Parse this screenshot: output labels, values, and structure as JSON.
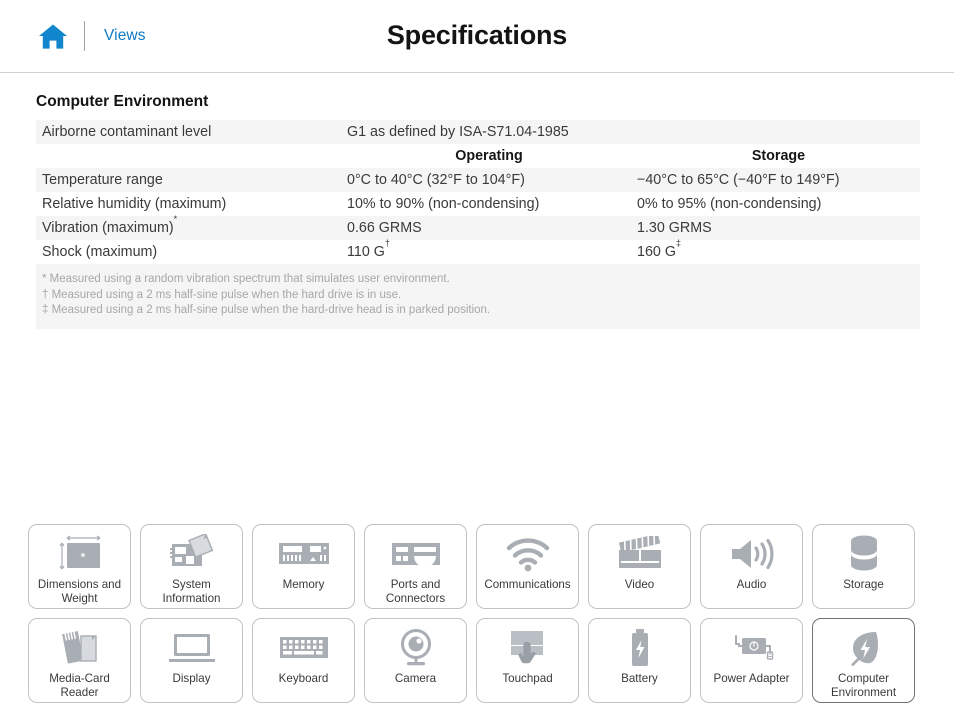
{
  "header": {
    "home_icon": "home-icon",
    "views_label": "Views",
    "title": "Specifications"
  },
  "main": {
    "section_title": "Computer Environment",
    "table": {
      "column_headers": [
        "",
        "Operating",
        "Storage"
      ],
      "airborne": {
        "label": "Airborne contaminant level",
        "value": "G1 as defined by ISA-S71.04-1985"
      },
      "rows": [
        {
          "label": "Temperature range",
          "marker": "",
          "operating": "0°C to 40°C (32°F to 104°F)",
          "operating_marker": "",
          "storage": "−40°C to 65°C (−40°F to 149°F)",
          "storage_marker": ""
        },
        {
          "label": "Relative humidity (maximum)",
          "marker": "",
          "operating": "10% to 90% (non-condensing)",
          "operating_marker": "",
          "storage": "0% to 95% (non-condensing)",
          "storage_marker": ""
        },
        {
          "label": "Vibration (maximum)",
          "marker": "*",
          "operating": "0.66 GRMS",
          "operating_marker": "",
          "storage": "1.30 GRMS",
          "storage_marker": ""
        },
        {
          "label": "Shock (maximum)",
          "marker": "",
          "operating": "110 G",
          "operating_marker": "†",
          "storage": "160 G",
          "storage_marker": "‡"
        }
      ]
    },
    "footnotes": [
      "* Measured using a random vibration spectrum that simulates user environment.",
      "† Measured using a 2 ms half-sine pulse when the hard drive is in use.",
      "‡ Measured using a 2 ms half-sine pulse when the hard-drive head is in parked position."
    ]
  },
  "nav_tiles": [
    {
      "label": "Dimensions and Weight",
      "icon": "dimensions-weight-icon",
      "active": false
    },
    {
      "label": "System Information",
      "icon": "system-information-icon",
      "active": false
    },
    {
      "label": "Memory",
      "icon": "memory-icon",
      "active": false
    },
    {
      "label": "Ports and Connectors",
      "icon": "ports-connectors-icon",
      "active": false
    },
    {
      "label": "Communications",
      "icon": "communications-icon",
      "active": false
    },
    {
      "label": "Video",
      "icon": "video-icon",
      "active": false
    },
    {
      "label": "Audio",
      "icon": "audio-icon",
      "active": false
    },
    {
      "label": "Storage",
      "icon": "storage-icon",
      "active": false
    },
    {
      "label": "Media-Card Reader",
      "icon": "media-card-reader-icon",
      "active": false
    },
    {
      "label": "Display",
      "icon": "display-icon",
      "active": false
    },
    {
      "label": "Keyboard",
      "icon": "keyboard-icon",
      "active": false
    },
    {
      "label": "Camera",
      "icon": "camera-icon",
      "active": false
    },
    {
      "label": "Touchpad",
      "icon": "touchpad-icon",
      "active": false
    },
    {
      "label": "Battery",
      "icon": "battery-icon",
      "active": false
    },
    {
      "label": "Power Adapter",
      "icon": "power-adapter-icon",
      "active": false
    },
    {
      "label": "Computer Environment",
      "icon": "computer-environment-icon",
      "active": true
    }
  ],
  "colors": {
    "accent_blue": "#0f7bc4",
    "icon_gray": "#a8aeb4",
    "zebra_row": "#f5f5f5",
    "tile_border": "#bfc3c7",
    "tile_border_active": "#6c7479",
    "footnote_text": "#a7a7a7"
  }
}
